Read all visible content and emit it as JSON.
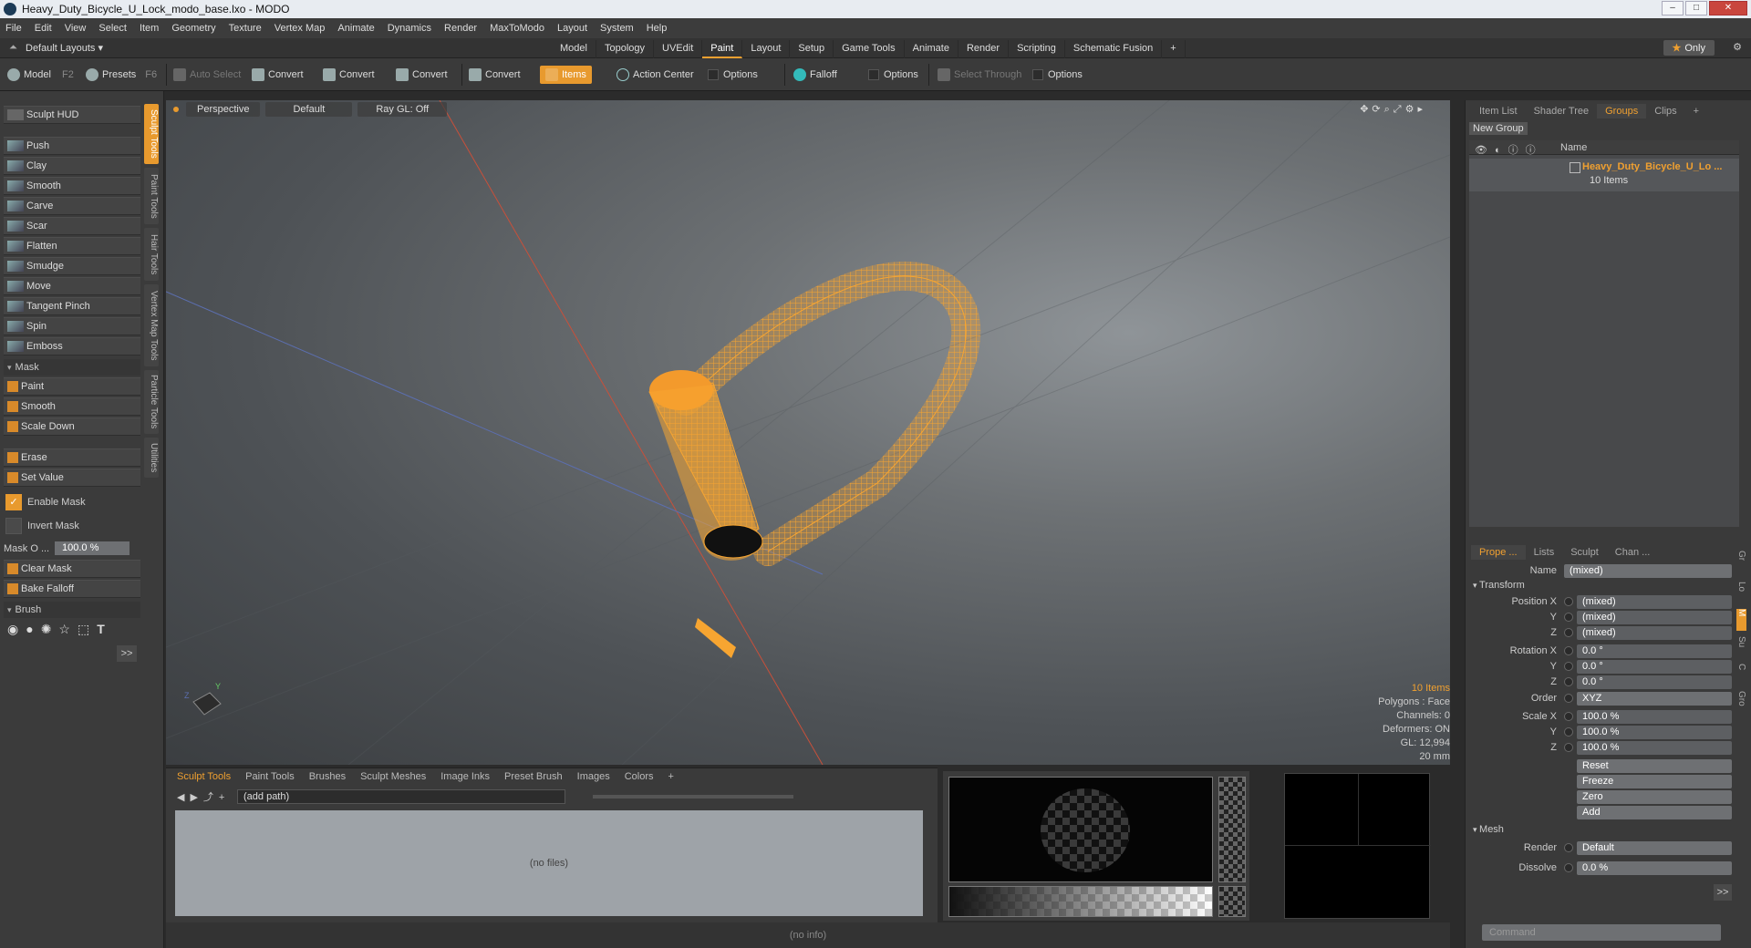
{
  "window": {
    "title": "Heavy_Duty_Bicycle_U_Lock_modo_base.lxo - MODO"
  },
  "menu": [
    "File",
    "Edit",
    "View",
    "Select",
    "Item",
    "Geometry",
    "Texture",
    "Vertex Map",
    "Animate",
    "Dynamics",
    "Render",
    "MaxToModo",
    "Layout",
    "System",
    "Help"
  ],
  "layoutbar": {
    "layouts_label": "Default Layouts ▾",
    "tabs": [
      "Model",
      "Topology",
      "UVEdit",
      "Paint",
      "Layout",
      "Setup",
      "Game Tools",
      "Animate",
      "Render",
      "Scripting",
      "Schematic Fusion"
    ],
    "active_tab": "Paint",
    "only_label": "Only"
  },
  "toolbar": {
    "model": "Model",
    "model_key": "F2",
    "presets": "Presets",
    "presets_key": "F6",
    "auto_select": "Auto Select",
    "convert1": "Convert",
    "convert2": "Convert",
    "convert3": "Convert",
    "convert4": "Convert",
    "items": "Items",
    "action_center": "Action Center",
    "options1": "Options",
    "falloff": "Falloff",
    "options2": "Options",
    "select_through": "Select Through",
    "options3": "Options"
  },
  "sculpt": {
    "hud": "Sculpt HUD",
    "tools": [
      "Push",
      "Clay",
      "Smooth",
      "Carve",
      "Scar",
      "Flatten",
      "Smudge",
      "Move",
      "Tangent Pinch",
      "Spin",
      "Emboss"
    ],
    "mask_header": "Mask",
    "mask_tools": [
      "Paint",
      "Smooth",
      "Scale Down"
    ],
    "erase": "Erase",
    "set_value": "Set Value",
    "enable_mask": "Enable Mask",
    "invert_mask": "Invert Mask",
    "mask_opacity_label": "Mask O ...",
    "mask_opacity_value": "100.0 %",
    "clear_mask": "Clear Mask",
    "bake_falloff": "Bake Falloff",
    "brush_header": "Brush",
    "more": ">>"
  },
  "vertical_tabs": [
    "Sculpt Tools",
    "Paint Tools",
    "Hair Tools",
    "Vertex Map Tools",
    "Particle Tools",
    "Utilities"
  ],
  "viewport": {
    "view": "Perspective",
    "shading": "Default",
    "raygl": "Ray GL: Off",
    "stats": {
      "items": "10 Items",
      "polygons": "Polygons : Face",
      "channels": "Channels: 0",
      "deformers": "Deformers: ON",
      "gl": "GL: 12,994",
      "scale": "20 mm"
    }
  },
  "browser": {
    "tabs": [
      "Sculpt Tools",
      "Paint Tools",
      "Brushes",
      "Sculpt Meshes",
      "Image Inks",
      "Preset Brush",
      "Images",
      "Colors"
    ],
    "path": "(add path)",
    "empty": "(no files)"
  },
  "status": "(no info)",
  "right": {
    "top_tabs": [
      "Item List",
      "Shader Tree",
      "Groups",
      "Clips"
    ],
    "active_top": "Groups",
    "new_group": "New Group",
    "col_name": "Name",
    "group_name": "Heavy_Duty_Bicycle_U_Lo ...",
    "group_count": "10 Items",
    "prop_tabs": [
      "Prope ...",
      "Lists",
      "Sculpt",
      "Chan ..."
    ],
    "name_label": "Name",
    "name_value": "(mixed)",
    "transform": "Transform",
    "position_label": "Position X",
    "position": [
      "(mixed)",
      "(mixed)",
      "(mixed)"
    ],
    "rotation_label": "Rotation X",
    "rotation": [
      "0.0 °",
      "0.0 °",
      "0.0 °"
    ],
    "order_label": "Order",
    "order": "XYZ",
    "scale_label": "Scale X",
    "scale": [
      "100.0 %",
      "100.0 %",
      "100.0 %"
    ],
    "y": "Y",
    "z": "Z",
    "actions": [
      "Reset",
      "Freeze",
      "Zero",
      "Add"
    ],
    "mesh": "Mesh",
    "render_label": "Render",
    "render": "Default",
    "dissolve_label": "Dissolve",
    "dissolve": "0.0 %",
    "more": ">>",
    "command_placeholder": "Command"
  }
}
